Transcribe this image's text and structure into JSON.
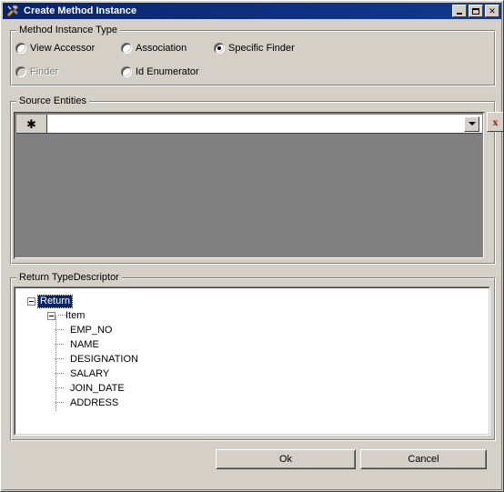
{
  "window": {
    "title": "Create Method Instance",
    "icon": "tools-hammer-wrench-icon",
    "controls": {
      "minimize": "Minimize",
      "maximize": "Maximize",
      "close": "✕"
    }
  },
  "method_instance_type": {
    "legend": "Method Instance Type",
    "options": [
      {
        "label": "View Accessor",
        "checked": false,
        "disabled": false
      },
      {
        "label": "Finder",
        "checked": false,
        "disabled": true
      },
      {
        "label": "Association",
        "checked": false,
        "disabled": false
      },
      {
        "label": "Id Enumerator",
        "checked": false,
        "disabled": false
      },
      {
        "label": "Specific Finder",
        "checked": true,
        "disabled": false
      }
    ],
    "selected": "Specific Finder"
  },
  "source_entities": {
    "legend": "Source Entities",
    "new_row_marker": "✱",
    "cell_value": "",
    "cell_placeholder": "",
    "dropdown_icon": "chevron-down-icon",
    "delete_label": "x",
    "grid_background": "#808080"
  },
  "return_typedescriptor": {
    "legend": "Return TypeDescriptor",
    "tree": {
      "root": {
        "label": "Return",
        "expanded": true,
        "selected": true
      },
      "child": {
        "label": "Item",
        "expanded": true,
        "selected": false
      },
      "fields": [
        "EMP_NO",
        "NAME",
        "DESIGNATION",
        "SALARY",
        "JOIN_DATE",
        "ADDRESS"
      ]
    }
  },
  "footer": {
    "ok_label": "Ok",
    "cancel_label": "Cancel"
  },
  "colors": {
    "dialog_face": "#d4d0c8",
    "titlebar": "#0a246a",
    "selection": "#0a246a",
    "grid_empty": "#808080",
    "delete_red": "#cc0000"
  }
}
